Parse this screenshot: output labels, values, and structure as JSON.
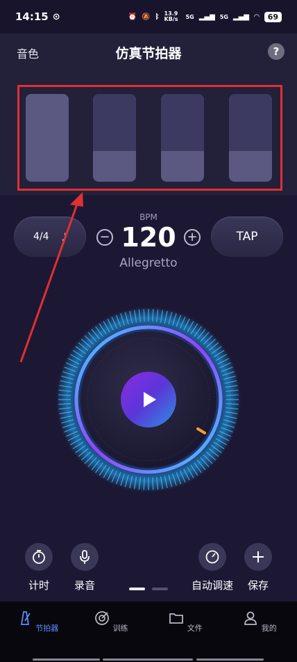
{
  "status": {
    "time": "14:15",
    "network_speed": "13.9 KB/s",
    "net1": "5G",
    "net2": "5G",
    "battery": "69"
  },
  "header": {
    "left_label": "音色",
    "title": "仿真节拍器",
    "help": "?"
  },
  "beats": [
    {
      "level": 1.0
    },
    {
      "level": 0.35
    },
    {
      "level": 0.35
    },
    {
      "level": 0.35
    }
  ],
  "controls": {
    "time_signature": "4/4",
    "note_glyph": "♩",
    "bpm_label": "BPM",
    "bpm_value": "120",
    "minus": "−",
    "plus": "+",
    "tempo_name": "Allegretto",
    "tap": "TAP"
  },
  "tools": {
    "timer": "计时",
    "record": "录音",
    "auto_tempo": "自动调速",
    "save": "保存"
  },
  "tabs": [
    {
      "label": "节拍器",
      "active": true
    },
    {
      "label": "训练",
      "active": false
    },
    {
      "label": "文件",
      "active": false
    },
    {
      "label": "我的",
      "active": false
    }
  ],
  "colors": {
    "accent": "#5a8dff",
    "annotation_red": "#e13030"
  }
}
